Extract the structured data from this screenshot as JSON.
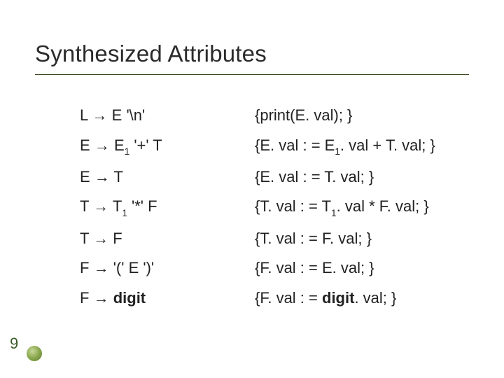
{
  "title": "Synthesized Attributes",
  "page_number": "9",
  "productions": {
    "p0": {
      "lhs": "L",
      "rhs_a": "E",
      "rhs_b": "'\\n'"
    },
    "p1": {
      "lhs": "E",
      "rhs_a": "E",
      "sub": "1",
      "op": "'+'",
      "rhs_b": "T"
    },
    "p2": {
      "lhs": "E",
      "rhs_a": "T"
    },
    "p3": {
      "lhs": "T",
      "rhs_a": "T",
      "sub": "1",
      "op": "'*'",
      "rhs_b": "F"
    },
    "p4": {
      "lhs": "T",
      "rhs_a": "F"
    },
    "p5": {
      "lhs": "F",
      "rhs_a": "'('",
      "rhs_b": "E",
      "rhs_c": "')'"
    },
    "p6": {
      "lhs": "F",
      "rhs_a": "digit"
    }
  },
  "semantics": {
    "s0": "{print(E. val); }",
    "s1": {
      "pre": "{E. val : = E",
      "sub": "1",
      "post": ". val + T. val; }"
    },
    "s2": "{E. val : = T. val; }",
    "s3": {
      "pre": "{T. val : = T",
      "sub": "1",
      "post": ". val * F. val; }"
    },
    "s4": "{T. val : = F. val; }",
    "s5": "{F. val : = E. val; }",
    "s6": {
      "pre": "{F. val : = ",
      "bold": "digit",
      "post": ". val; }"
    }
  },
  "arrow": "→"
}
